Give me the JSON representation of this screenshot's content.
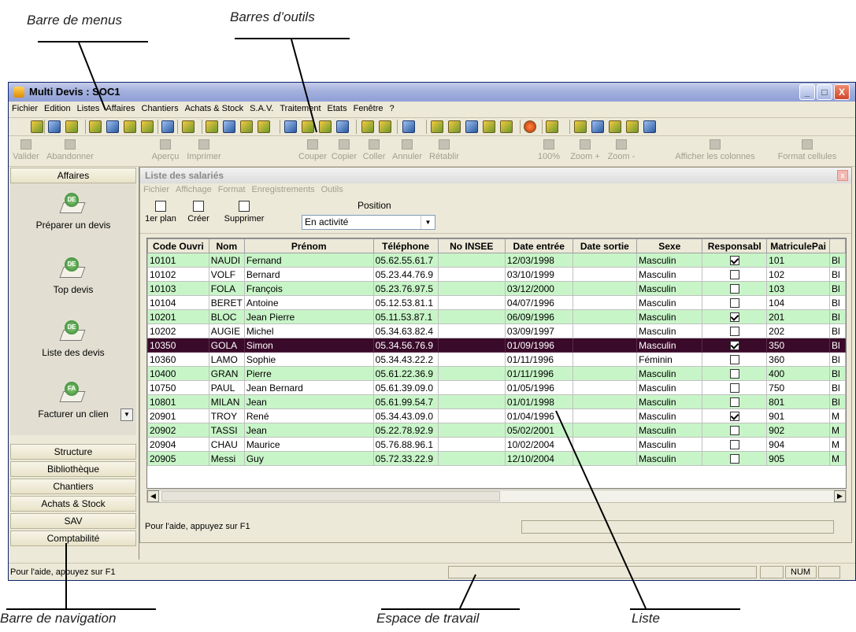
{
  "annotations": {
    "menus": "Barre de menus",
    "toolbars": "Barres d’outils",
    "navigation": "Barre de navigation",
    "workspace": "Espace de travail",
    "list": "Liste"
  },
  "window": {
    "title": "Multi Devis : SOC1",
    "controls": {
      "minimize": "_",
      "maximize": "□",
      "close": "X"
    }
  },
  "menubar": [
    "Fichier",
    "Edition",
    "Listes",
    "Affaires",
    "Chantiers",
    "Achats & Stock",
    "S.A.V.",
    "Traitement",
    "Etats",
    "Fenêtre",
    "?"
  ],
  "toolbar2": [
    {
      "name": "valider",
      "label": "Valider"
    },
    {
      "name": "abandonner",
      "label": "Abandonner"
    },
    {
      "name": "apercu",
      "label": "Aperçu"
    },
    {
      "name": "imprimer",
      "label": "Imprimer"
    },
    {
      "name": "couper",
      "label": "Couper"
    },
    {
      "name": "copier",
      "label": "Copier"
    },
    {
      "name": "coller",
      "label": "Coller"
    },
    {
      "name": "annuler",
      "label": "Annuler"
    },
    {
      "name": "retablir",
      "label": "Rétablir"
    },
    {
      "name": "zoom-100",
      "label": "100%"
    },
    {
      "name": "zoom-plus",
      "label": "Zoom +"
    },
    {
      "name": "zoom-minus",
      "label": "Zoom -"
    },
    {
      "name": "afficher-colonnes",
      "label": "Afficher les colonnes"
    },
    {
      "name": "format-cellules",
      "label": "Format cellules"
    }
  ],
  "nav": {
    "affaires": "Affaires",
    "items": [
      "Préparer un devis",
      "Top devis",
      "Liste des devis",
      "Facturer un clien"
    ],
    "icon_badges": [
      "DE",
      "DE",
      "DE",
      "FA"
    ],
    "dropdown": "▼",
    "sections": [
      "Structure",
      "Bibliothèque",
      "Chantiers",
      "Achats & Stock",
      "SAV",
      "Comptabilité"
    ]
  },
  "child": {
    "title": "Liste des salariés",
    "close": "x",
    "menu": [
      "Fichier",
      "Affichage",
      "Format",
      "Enregistrements",
      "Outils"
    ],
    "toolbar": {
      "premier_plan": "1er plan",
      "creer": "Créer",
      "supprimer": "Supprimer"
    },
    "position": {
      "label": "Position",
      "value": "En activité",
      "arrow": "▼"
    },
    "scroll": {
      "left": "◀",
      "right": "▶"
    },
    "status": "Pour l'aide, appuyez sur F1"
  },
  "table": {
    "columns": [
      "Code Ouvri",
      "Nom",
      "Prénom",
      "Téléphone",
      "No INSEE",
      "Date entrée",
      "Date sortie",
      "Sexe",
      "Responsabl",
      "MatriculePai",
      ""
    ],
    "rows": [
      [
        "10101",
        "NAUDI",
        "Fernand",
        "05.62.55.61.7",
        "",
        "12/03/1998",
        "",
        "Masculin",
        true,
        "101",
        "Bl"
      ],
      [
        "10102",
        "VOLF",
        "Bernard",
        "05.23.44.76.9",
        "",
        "03/10/1999",
        "",
        "Masculin",
        false,
        "102",
        "Bl"
      ],
      [
        "10103",
        "FOLA",
        "François",
        "05.23.76.97.5",
        "",
        "03/12/2000",
        "",
        "Masculin",
        false,
        "103",
        "Bl"
      ],
      [
        "10104",
        "BERET",
        "Antoine",
        "05.12.53.81.1",
        "",
        "04/07/1996",
        "",
        "Masculin",
        false,
        "104",
        "Bl"
      ],
      [
        "10201",
        "BLOC",
        "Jean Pierre",
        "05.11.53.87.1",
        "",
        "06/09/1996",
        "",
        "Masculin",
        true,
        "201",
        "Bl"
      ],
      [
        "10202",
        "AUGIE",
        "Michel",
        "05.34.63.82.4",
        "",
        "03/09/1997",
        "",
        "Masculin",
        false,
        "202",
        "Bl"
      ],
      [
        "10350",
        "GOLA",
        "Simon",
        "05.34.56.76.9",
        "",
        "01/09/1996",
        "",
        "Masculin",
        true,
        "350",
        "Bl"
      ],
      [
        "10360",
        "LAMO",
        "Sophie",
        "05.34.43.22.2",
        "",
        "01/11/1996",
        "",
        "Féminin",
        false,
        "360",
        "Bl"
      ],
      [
        "10400",
        "GRAN",
        "Pierre",
        "05.61.22.36.9",
        "",
        "01/11/1996",
        "",
        "Masculin",
        false,
        "400",
        "Bl"
      ],
      [
        "10750",
        "PAUL",
        "Jean Bernard",
        "05.61.39.09.0",
        "",
        "01/05/1996",
        "",
        "Masculin",
        false,
        "750",
        "Bl"
      ],
      [
        "10801",
        "MILAN",
        "Jean",
        "05.61.99.54.7",
        "",
        "01/01/1998",
        "",
        "Masculin",
        false,
        "801",
        "Bl"
      ],
      [
        "20901",
        "TROY",
        "René",
        "05.34.43.09.0",
        "",
        "01/04/1996",
        "",
        "Masculin",
        true,
        "901",
        "M"
      ],
      [
        "20902",
        "TASSI",
        "Jean",
        "05.22.78.92.9",
        "",
        "05/02/2001",
        "",
        "Masculin",
        false,
        "902",
        "M"
      ],
      [
        "20904",
        "CHAU",
        "Maurice",
        "05.76.88.96.1",
        "",
        "10/02/2004",
        "",
        "Masculin",
        false,
        "904",
        "M"
      ],
      [
        "20905",
        "Messi",
        "Guy",
        "05.72.33.22.9",
        "",
        "12/10/2004",
        "",
        "Masculin",
        false,
        "905",
        "M"
      ]
    ],
    "selected_index": 6,
    "row_colors": {
      "green": "#c8f5c8",
      "selected": "#3a0a2a"
    }
  },
  "statusbar": {
    "text": "Pour l'aide, appuyez sur F1",
    "num": "NUM"
  }
}
